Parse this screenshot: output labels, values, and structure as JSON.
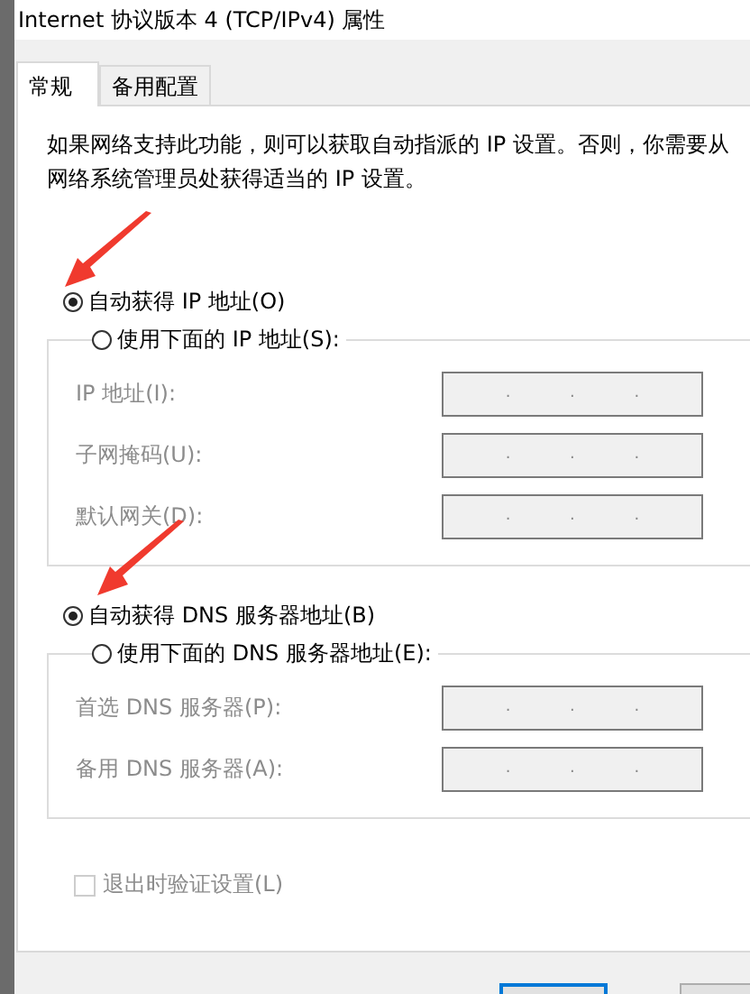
{
  "window": {
    "title": "Internet 协议版本 4 (TCP/IPv4) 属性"
  },
  "tabs": [
    {
      "label": "常规",
      "selected": true
    },
    {
      "label": "备用配置",
      "selected": false
    }
  ],
  "description": "如果网络支持此功能，则可以获取自动指派的 IP 设置。否则，你需要从网络系统管理员处获得适当的 IP 设置。",
  "sections": [
    {
      "auto_option": {
        "label": "自动获得 IP 地址(O)",
        "selected": true
      },
      "manual_option": {
        "label": "使用下面的 IP 地址(S):",
        "selected": false
      },
      "fields": [
        {
          "label": "IP 地址(I):",
          "disabled": true,
          "dots": [
            ".",
            ".",
            "."
          ]
        },
        {
          "label": "子网掩码(U):",
          "disabled": true,
          "dots": [
            ".",
            ".",
            "."
          ]
        },
        {
          "label": "默认网关(D):",
          "disabled": true,
          "dots": [
            ".",
            ".",
            "."
          ]
        }
      ]
    },
    {
      "auto_option": {
        "label": "自动获得 DNS 服务器地址(B)",
        "selected": true
      },
      "manual_option": {
        "label": "使用下面的 DNS 服务器地址(E):",
        "selected": false
      },
      "fields": [
        {
          "label": "首选 DNS 服务器(P):",
          "disabled": true,
          "dots": [
            ".",
            ".",
            "."
          ]
        },
        {
          "label": "备用 DNS 服务器(A):",
          "disabled": true,
          "dots": [
            ".",
            ".",
            "."
          ]
        }
      ]
    }
  ],
  "validate_checkbox": {
    "label": "退出时验证设置(L)",
    "checked": false,
    "disabled": true
  }
}
